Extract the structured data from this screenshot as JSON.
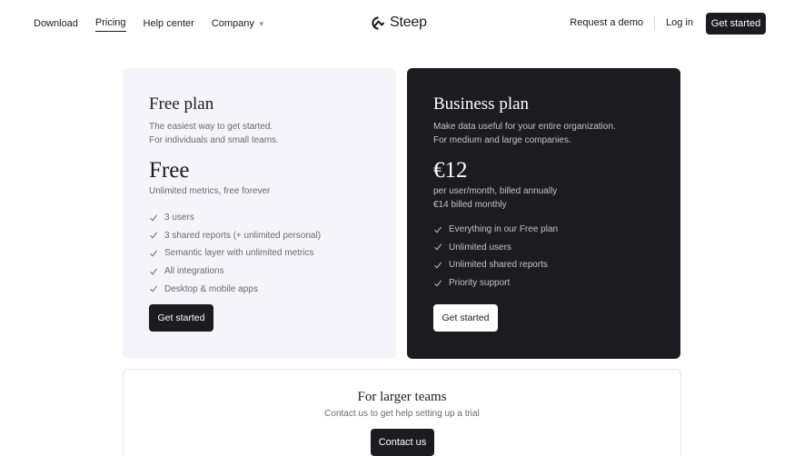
{
  "nav": {
    "links": [
      "Download",
      "Pricing",
      "Help center",
      "Company"
    ],
    "active": "Pricing",
    "logo_text": "Steep",
    "request_demo": "Request a demo",
    "login": "Log in",
    "get_started": "Get started"
  },
  "free_plan": {
    "title": "Free plan",
    "desc_line1": "The easiest way to get started.",
    "desc_line2": "For individuals and small teams.",
    "price": "Free",
    "price_sub": "Unlimited metrics, free forever",
    "features": [
      "3 users",
      "3 shared reports (+ unlimited personal)",
      "Semantic layer with unlimited metrics",
      "All integrations",
      "Desktop & mobile apps"
    ],
    "button": "Get started"
  },
  "business_plan": {
    "title": "Business plan",
    "desc_line1": "Make data useful for your entire organization.",
    "desc_line2": "For medium and large companies.",
    "price": "€12",
    "price_sub1": "per user/month, billed annually",
    "price_sub2": "€14 billed monthly",
    "features": [
      "Everything in our Free plan",
      "Unlimited users",
      "Unlimited shared reports",
      "Priority support"
    ],
    "button": "Get started"
  },
  "larger_teams": {
    "title": "For larger teams",
    "subtitle": "Contact us to get help setting up a trial",
    "button": "Contact us"
  },
  "colors": {
    "dark": "#1c1b1f",
    "light_card": "#f5f4fa",
    "muted_text": "#6b6970"
  }
}
